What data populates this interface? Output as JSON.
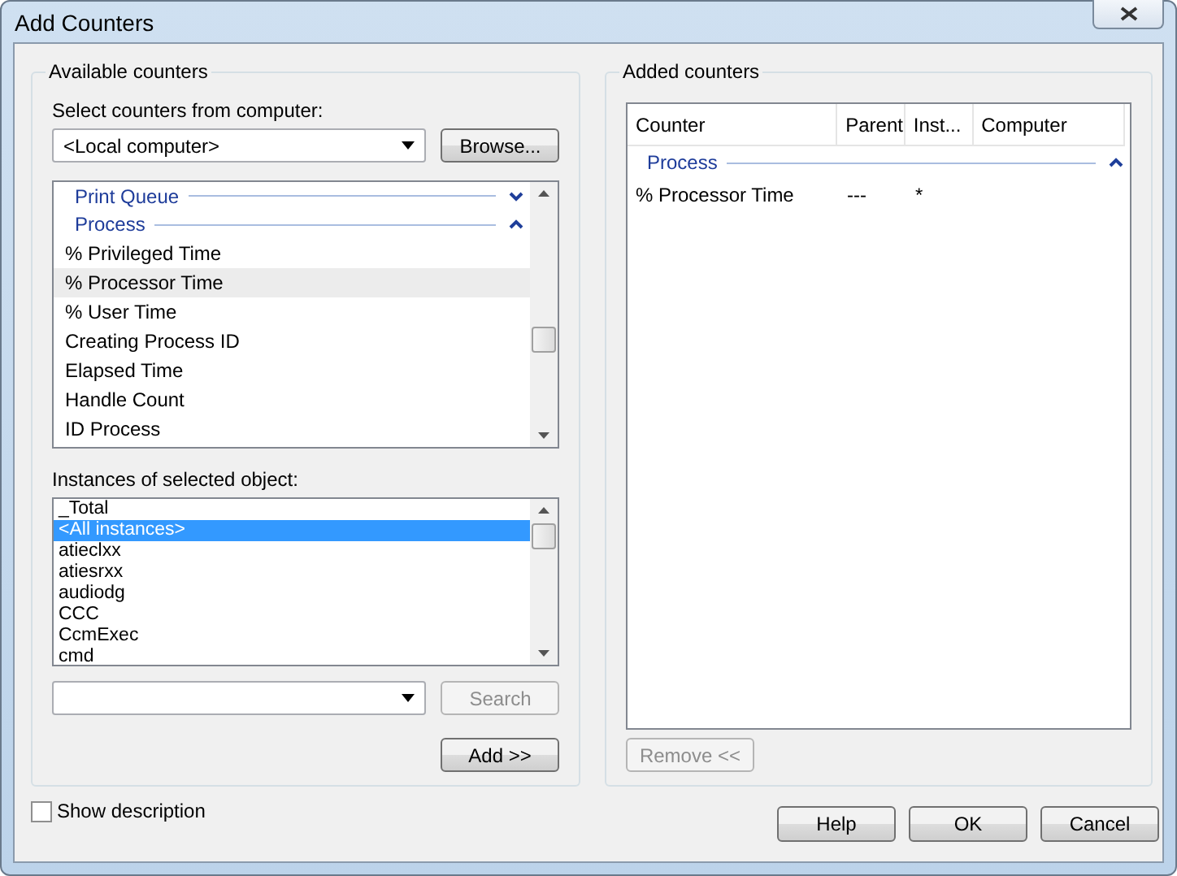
{
  "window": {
    "title": "Add Counters"
  },
  "available_counters": {
    "title": "Available counters",
    "computer_label": "Select counters from computer:",
    "computer_value": "<Local computer>",
    "browse_button": "Browse...",
    "counters": [
      {
        "kind": "group",
        "label": "Print Queue",
        "expanded": false
      },
      {
        "kind": "group",
        "label": "Process",
        "expanded": true
      },
      {
        "kind": "item",
        "label": "% Privileged Time",
        "selected": false
      },
      {
        "kind": "item",
        "label": "% Processor Time",
        "selected": true
      },
      {
        "kind": "item",
        "label": "% User Time",
        "selected": false
      },
      {
        "kind": "item",
        "label": "Creating Process ID",
        "selected": false
      },
      {
        "kind": "item",
        "label": "Elapsed Time",
        "selected": false
      },
      {
        "kind": "item",
        "label": "Handle Count",
        "selected": false
      },
      {
        "kind": "item",
        "label": "ID Process",
        "selected": false
      }
    ],
    "instances_label": "Instances of selected object:",
    "instances": [
      {
        "label": "_Total",
        "selected": false
      },
      {
        "label": "<All instances>",
        "selected": true
      },
      {
        "label": "atieclxx",
        "selected": false
      },
      {
        "label": "atiesrxx",
        "selected": false
      },
      {
        "label": "audiodg",
        "selected": false
      },
      {
        "label": "CCC",
        "selected": false
      },
      {
        "label": "CcmExec",
        "selected": false
      },
      {
        "label": "cmd",
        "selected": false
      }
    ],
    "search_button": {
      "label": "Search",
      "disabled": true
    },
    "add_button": "Add >>"
  },
  "added_counters": {
    "title": "Added counters",
    "columns": [
      "Counter",
      "Parent",
      "Inst...",
      "Computer"
    ],
    "groups": [
      {
        "label": "Process",
        "expanded": true,
        "rows": [
          {
            "counter": "% Processor Time",
            "parent": "---",
            "instance": "*"
          }
        ]
      }
    ],
    "remove_button": {
      "label": "Remove <<",
      "disabled": true
    }
  },
  "show_description": {
    "label": "Show description",
    "checked": false
  },
  "buttons": [
    "Help",
    "OK",
    "Cancel"
  ]
}
